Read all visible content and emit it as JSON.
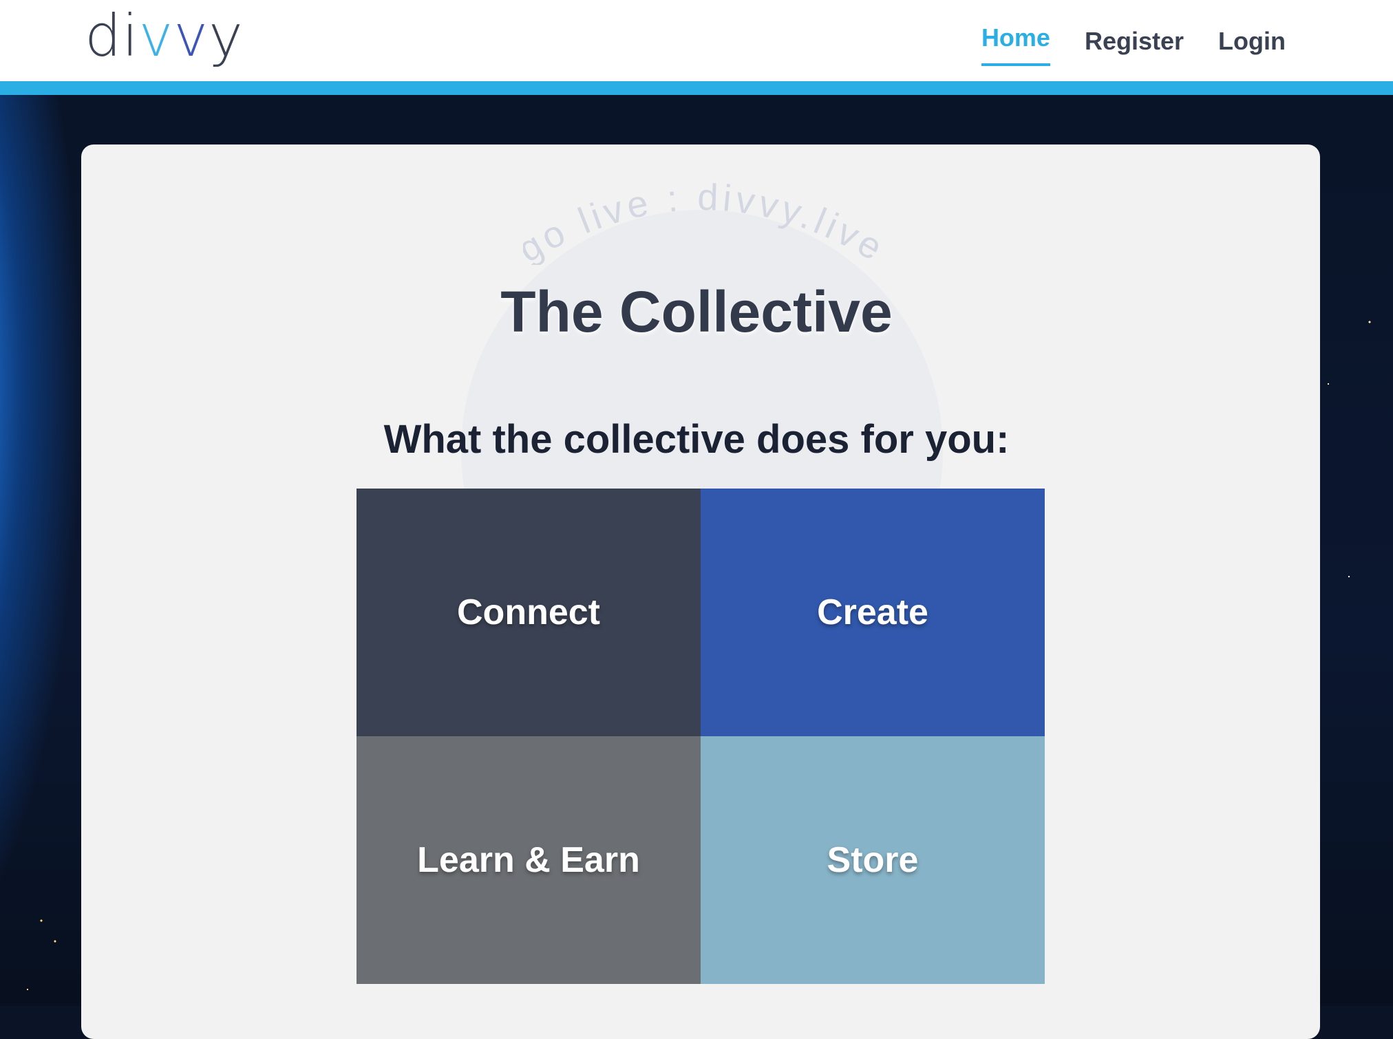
{
  "header": {
    "logo": {
      "d": "d",
      "i": "i",
      "v1": "v",
      "v2": "v",
      "y": "y"
    },
    "nav": [
      {
        "label": "Home",
        "active": true
      },
      {
        "label": "Register",
        "active": false
      },
      {
        "label": "Login",
        "active": false
      }
    ]
  },
  "colors": {
    "accent": "#2aaee3",
    "tile_connect": "#3a4152",
    "tile_create": "#3158ac",
    "tile_learn": "#6b6f73",
    "tile_store": "#87b3c8"
  },
  "watermark": {
    "arc_text": "go live : divvy.live"
  },
  "main": {
    "title": "The Collective",
    "subtitle": "What the collective does for you:",
    "tiles": [
      {
        "label": "Connect"
      },
      {
        "label": "Create"
      },
      {
        "label": "Learn & Earn"
      },
      {
        "label": "Store"
      }
    ]
  }
}
